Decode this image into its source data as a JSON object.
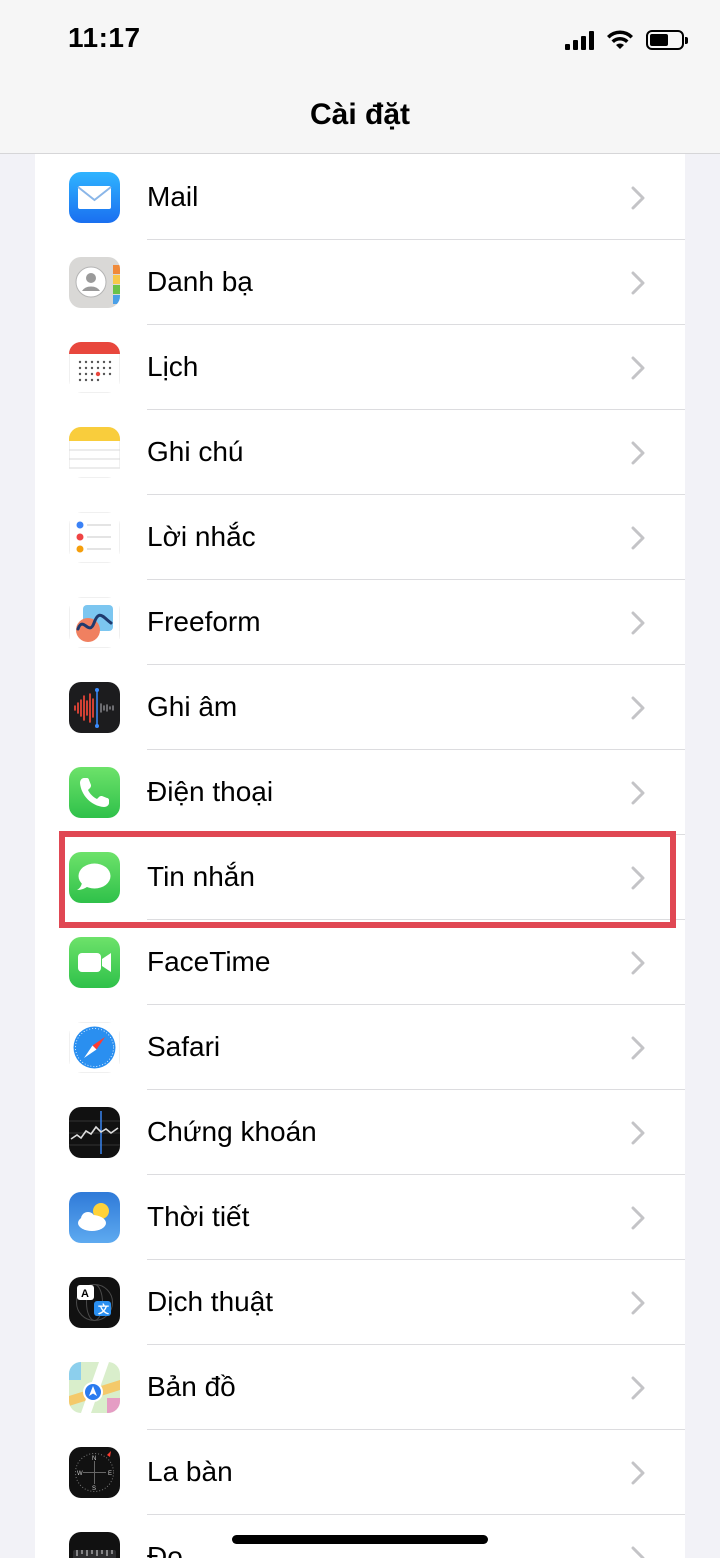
{
  "status_bar": {
    "time": "11:17"
  },
  "nav": {
    "title": "Cài đặt"
  },
  "items": [
    {
      "label": "Mail",
      "icon": "mail-icon"
    },
    {
      "label": "Danh bạ",
      "icon": "contacts-icon"
    },
    {
      "label": "Lịch",
      "icon": "calendar-icon"
    },
    {
      "label": "Ghi chú",
      "icon": "notes-icon"
    },
    {
      "label": "Lời nhắc",
      "icon": "reminders-icon"
    },
    {
      "label": "Freeform",
      "icon": "freeform-icon"
    },
    {
      "label": "Ghi âm",
      "icon": "voice-memos-icon"
    },
    {
      "label": "Điện thoại",
      "icon": "phone-icon"
    },
    {
      "label": "Tin nhắn",
      "icon": "messages-icon"
    },
    {
      "label": "FaceTime",
      "icon": "facetime-icon"
    },
    {
      "label": "Safari",
      "icon": "safari-icon"
    },
    {
      "label": "Chứng khoán",
      "icon": "stocks-icon"
    },
    {
      "label": "Thời tiết",
      "icon": "weather-icon"
    },
    {
      "label": "Dịch thuật",
      "icon": "translate-icon"
    },
    {
      "label": "Bản đồ",
      "icon": "maps-icon"
    },
    {
      "label": "La bàn",
      "icon": "compass-icon"
    },
    {
      "label": "Đo",
      "icon": "measure-icon"
    }
  ],
  "highlighted_item": "Tin nhắn",
  "colors": {
    "highlight": "#e04753",
    "background": "#f2f2f7"
  }
}
